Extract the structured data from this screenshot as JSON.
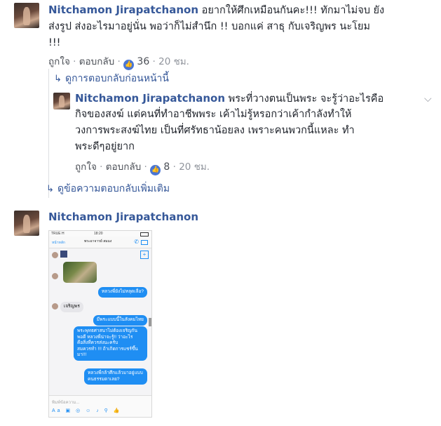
{
  "comment1": {
    "author": "Nitchamon Jirapatchanon",
    "text_line1": "อยากให้ศึกเหมือนกันคะ!!! ทักมาไม่จบ ยัง",
    "text_line2": "ส่งรูป ส่งอะไรมาอยู่นั่น พอว่าก็ไม่สำนึก !! บอกแค่ สาธุ กับเจริญพร นะโยม",
    "text_line3": "!!!",
    "like_label": "ถูกใจ",
    "reply_label": "ตอบกลับ",
    "sep": "·",
    "reaction_count": "36",
    "time": "20 ชม."
  },
  "previous_replies_label": "ดูการตอบกลับก่อนหน้านี้",
  "reply1": {
    "author": "Nitchamon Jirapatchanon",
    "text_first": "พระที่วางตนเป็นพระ จะรู้ว่าอะไรคือ",
    "text_line2": "กิจของสงฆ์ แต่คนที่ทำอาชีพพระ เค้าไม่รู้หรอกว่าเค้ากำลังทำให้",
    "text_line3": "วงการพระสงฆ์ไทย เป็นที่ศรัทธาน้อยลง เพราะคนพวกนี้แหละ ทำ",
    "text_line4": "พระดีๆอยู่ยาก",
    "like_label": "ถูกใจ",
    "reply_label": "ตอบกลับ",
    "sep": "·",
    "reaction_count": "8",
    "time": "20 ชม."
  },
  "more_replies_label": "ดูข้อความตอบกลับเพิ่มเติม",
  "comment2": {
    "author": "Nitchamon Jirapatchanon"
  },
  "screenshot": {
    "status_left": "TRUE H",
    "status_time": "18:20",
    "back_label": "หน้าหลัก",
    "chat_title": "พระอาจารย์ สมมง",
    "msg_question": "หลวงพี่ยังไม่หลุดเลือ?",
    "msg_in_1": "เจริญพร",
    "msg_out_1": "มีพระแบบนี้ในสังคมไทย",
    "msg_out_2a": "พระพุทธศาสนาไม่ต้องเจริญกัน",
    "msg_out_2b": "พอดี หลวงพี่น่าจะรู้!! ว่าอะไร",
    "msg_out_2c": "คือสิ่งที่ควรส่งนะครับ",
    "msg_out_2d": "สมควรทำ !!! ถ้าเกิดการแชร์ขึ้น",
    "msg_out_2e": "มา!!!",
    "msg_out_3a": "หลวงพี่กล้าศึกแล้วมาอยู่แบบ",
    "msg_out_3b": "คนธรรมดาเลย?",
    "input_placeholder": "พิมพ์ข้อความ..."
  }
}
